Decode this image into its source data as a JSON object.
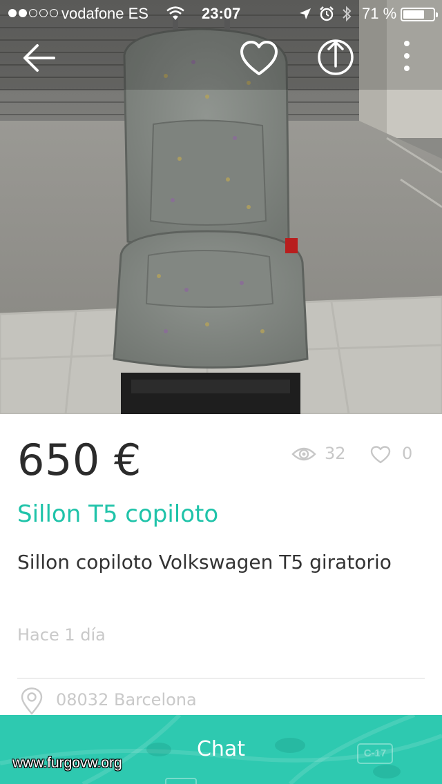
{
  "status_bar": {
    "carrier": "vodafone ES",
    "time": "23:07",
    "battery_percent": "71 %",
    "battery_level": 0.71,
    "signal_bars_filled": 2,
    "signal_bars_total": 5
  },
  "nav": {
    "icons": [
      "back-arrow-icon",
      "heart-icon",
      "share-icon",
      "more-vertical-icon"
    ]
  },
  "listing": {
    "price": "650 €",
    "views": "32",
    "likes": "0",
    "title": "Sillon T5 copiloto",
    "description": "Sillon copiloto Volkswagen T5 giratorio",
    "posted": "Hace 1 día",
    "location": "08032 Barcelona"
  },
  "chat_bar": {
    "label": "Chat",
    "map_road_sign": "C-17"
  },
  "watermark": "www.furgovw.org",
  "colors": {
    "accent": "#1fc3a9",
    "chat_bar": "#2ec9b0",
    "price_text": "#2b2b2b",
    "muted_text": "#c9c9c9"
  }
}
